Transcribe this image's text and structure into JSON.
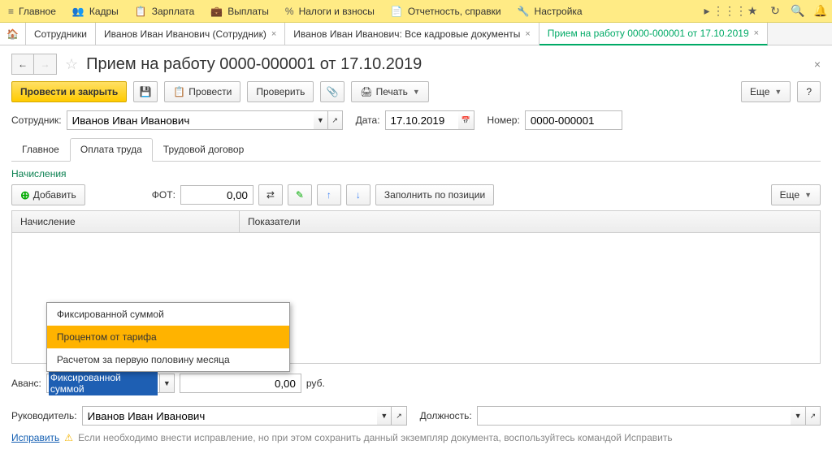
{
  "topnav": {
    "items": [
      {
        "label": "Главное"
      },
      {
        "label": "Кадры"
      },
      {
        "label": "Зарплата"
      },
      {
        "label": "Выплаты"
      },
      {
        "label": "Налоги и взносы"
      },
      {
        "label": "Отчетность, справки"
      },
      {
        "label": "Настройка"
      }
    ]
  },
  "tabs": {
    "items": [
      {
        "label": "Сотрудники"
      },
      {
        "label": "Иванов Иван Иванович (Сотрудник)"
      },
      {
        "label": "Иванов Иван Иванович: Все кадровые документы"
      },
      {
        "label": "Прием на работу 0000-000001 от 17.10.2019"
      }
    ]
  },
  "page": {
    "title": "Прием на работу 0000-000001 от 17.10.2019"
  },
  "toolbar": {
    "post_close": "Провести и закрыть",
    "post": "Провести",
    "check": "Проверить",
    "print": "Печать",
    "more": "Еще",
    "help": "?"
  },
  "form": {
    "employee_label": "Сотрудник:",
    "employee_value": "Иванов Иван Иванович",
    "date_label": "Дата:",
    "date_value": "17.10.2019",
    "number_label": "Номер:",
    "number_value": "0000-000001"
  },
  "subtabs": {
    "main": "Главное",
    "salary": "Оплата труда",
    "contract": "Трудовой договор"
  },
  "accruals": {
    "section": "Начисления",
    "add": "Добавить",
    "fot_label": "ФОТ:",
    "fot_value": "0,00",
    "fill_by_position": "Заполнить по позиции",
    "more": "Еще",
    "col1": "Начисление",
    "col2": "Показатели"
  },
  "avans": {
    "label": "Аванс:",
    "value": "Фиксированной суммой",
    "amount": "0,00",
    "currency": "руб.",
    "options": [
      "Фиксированной суммой",
      "Процентом от тарифа",
      "Расчетом за первую половину месяца"
    ]
  },
  "footer": {
    "manager_label": "Руководитель:",
    "manager_value": "Иванов Иван Иванович",
    "position_label": "Должность:",
    "fix_link": "Исправить",
    "warn_text": "Если необходимо внести исправление, но при этом сохранить данный экземпляр документа, воспользуйтесь командой Исправить"
  }
}
